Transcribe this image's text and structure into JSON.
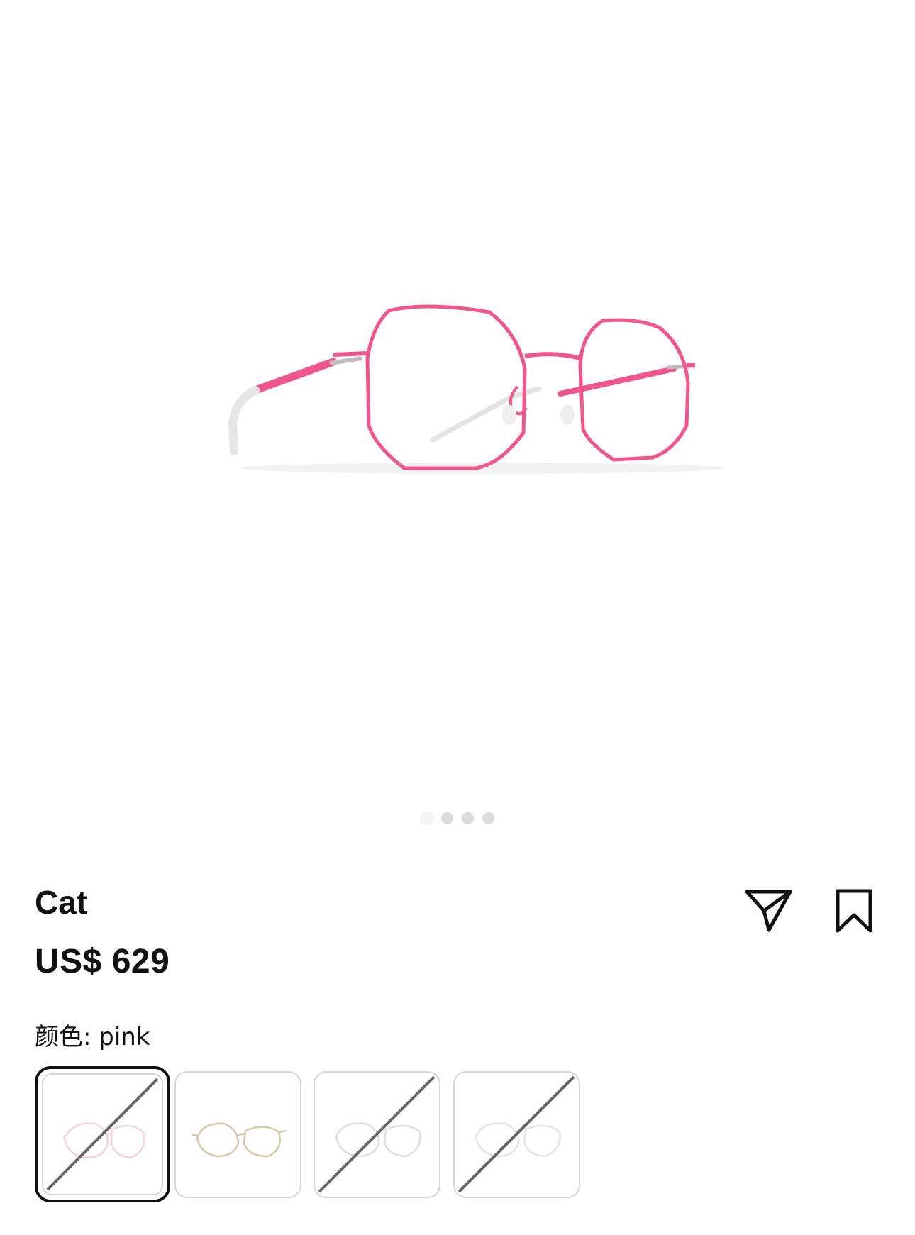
{
  "product": {
    "name": "Cat",
    "price": "US$ 629",
    "color_label": "颜色: pink"
  },
  "gallery": {
    "image_count": 4,
    "active_index": 0
  },
  "icons": {
    "share": "send-icon",
    "bookmark": "bookmark-icon"
  },
  "colors": {
    "frame_pink": "#f0558e",
    "text": "#111111",
    "swatch_border": "#d6d6d6"
  },
  "swatches": [
    {
      "name": "pink",
      "selected": true,
      "available": false
    },
    {
      "name": "gold",
      "selected": false,
      "available": true
    },
    {
      "name": "silver",
      "selected": false,
      "available": false
    },
    {
      "name": "white",
      "selected": false,
      "available": false
    }
  ]
}
